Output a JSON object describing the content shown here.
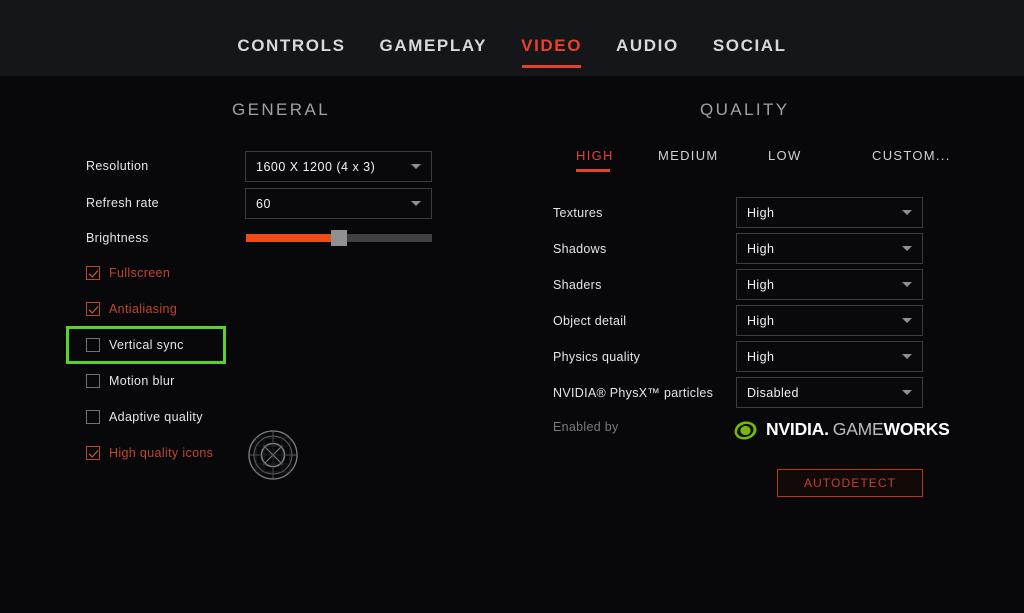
{
  "nav": {
    "items": [
      {
        "label": "CONTROLS",
        "active": false
      },
      {
        "label": "GAMEPLAY",
        "active": false
      },
      {
        "label": "VIDEO",
        "active": true
      },
      {
        "label": "AUDIO",
        "active": false
      },
      {
        "label": "SOCIAL",
        "active": false
      }
    ]
  },
  "general": {
    "title": "GENERAL",
    "resolution": {
      "label": "Resolution",
      "value": "1600 X 1200 (4 x 3)"
    },
    "refresh_rate": {
      "label": "Refresh rate",
      "value": "60"
    },
    "brightness": {
      "label": "Brightness",
      "percent": 50
    },
    "checkboxes": [
      {
        "label": "Fullscreen",
        "checked": true
      },
      {
        "label": "Antialiasing",
        "checked": true
      },
      {
        "label": "Vertical sync",
        "checked": false,
        "highlighted": true
      },
      {
        "label": "Motion blur",
        "checked": false
      },
      {
        "label": "Adaptive quality",
        "checked": false
      },
      {
        "label": "High quality icons",
        "checked": true
      }
    ]
  },
  "quality": {
    "title": "QUALITY",
    "presets": [
      {
        "label": "HIGH",
        "active": true
      },
      {
        "label": "MEDIUM",
        "active": false
      },
      {
        "label": "LOW",
        "active": false
      },
      {
        "label": "CUSTOM...",
        "active": false
      }
    ],
    "settings": [
      {
        "label": "Textures",
        "value": "High"
      },
      {
        "label": "Shadows",
        "value": "High"
      },
      {
        "label": "Shaders",
        "value": "High"
      },
      {
        "label": "Object detail",
        "value": "High"
      },
      {
        "label": "Physics quality",
        "value": "High"
      },
      {
        "label": "NVIDIA® PhysX™ particles",
        "value": "Disabled"
      }
    ],
    "enabled_by": "Enabled by",
    "logo": {
      "nvidia": "NVIDIA.",
      "game": "GAME",
      "works": "WORKS"
    },
    "autodetect": "AUTODETECT"
  },
  "colors": {
    "accent_red": "#e8412a",
    "checked_red": "#c0452e",
    "highlight_green": "#5ad226",
    "slider_orange": "#ef4d18",
    "nvidia_green": "#76b900",
    "background": "#08080a",
    "topbar": "#14161a"
  }
}
